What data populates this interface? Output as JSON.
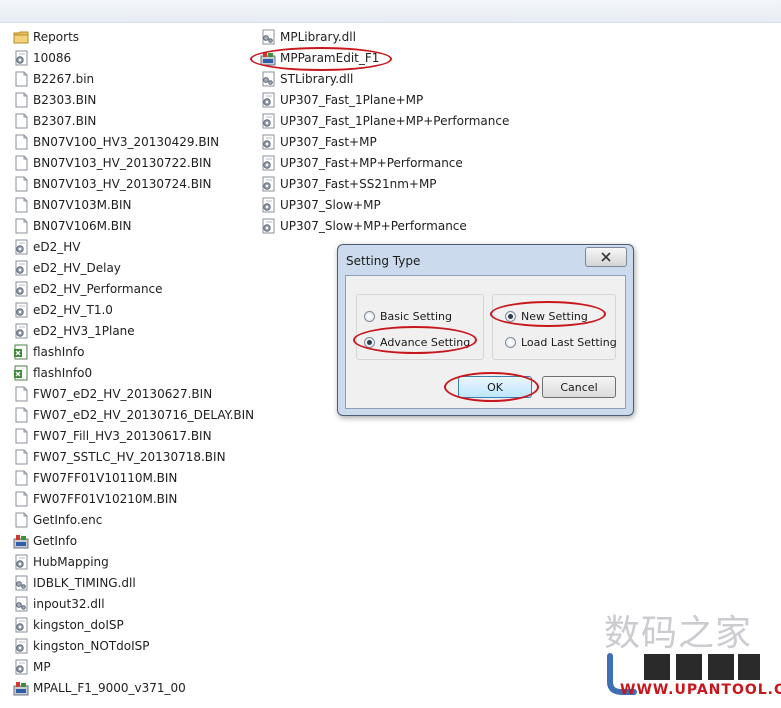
{
  "files_left": [
    {
      "name": "Reports",
      "icon": "folder-icon"
    },
    {
      "name": "10086",
      "icon": "config-file-icon"
    },
    {
      "name": "B2267.bin",
      "icon": "blank-file-icon"
    },
    {
      "name": "B2303.BIN",
      "icon": "blank-file-icon"
    },
    {
      "name": "B2307.BIN",
      "icon": "blank-file-icon"
    },
    {
      "name": "BN07V100_HV3_20130429.BIN",
      "icon": "blank-file-icon"
    },
    {
      "name": "BN07V103_HV_20130722.BIN",
      "icon": "blank-file-icon"
    },
    {
      "name": "BN07V103_HV_20130724.BIN",
      "icon": "blank-file-icon"
    },
    {
      "name": "BN07V103M.BIN",
      "icon": "blank-file-icon"
    },
    {
      "name": "BN07V106M.BIN",
      "icon": "blank-file-icon"
    },
    {
      "name": "eD2_HV",
      "icon": "config-file-icon"
    },
    {
      "name": "eD2_HV_Delay",
      "icon": "config-file-icon"
    },
    {
      "name": "eD2_HV_Performance",
      "icon": "config-file-icon"
    },
    {
      "name": "eD2_HV_T1.0",
      "icon": "config-file-icon"
    },
    {
      "name": "eD2_HV3_1Plane",
      "icon": "config-file-icon"
    },
    {
      "name": "flashInfo",
      "icon": "spreadsheet-file-icon"
    },
    {
      "name": "flashInfo0",
      "icon": "spreadsheet-file-icon"
    },
    {
      "name": "FW07_eD2_HV_20130627.BIN",
      "icon": "blank-file-icon"
    },
    {
      "name": "FW07_eD2_HV_20130716_DELAY.BIN",
      "icon": "blank-file-icon"
    },
    {
      "name": "FW07_Fill_HV3_20130617.BIN",
      "icon": "blank-file-icon"
    },
    {
      "name": "FW07_SSTLC_HV_20130718.BIN",
      "icon": "blank-file-icon"
    },
    {
      "name": "FW07FF01V10110M.BIN",
      "icon": "blank-file-icon"
    },
    {
      "name": "FW07FF01V10210M.BIN",
      "icon": "blank-file-icon"
    },
    {
      "name": "GetInfo.enc",
      "icon": "blank-file-icon"
    },
    {
      "name": "GetInfo",
      "icon": "application-icon"
    },
    {
      "name": "HubMapping",
      "icon": "config-file-icon"
    },
    {
      "name": "IDBLK_TIMING.dll",
      "icon": "dll-file-icon"
    },
    {
      "name": "inpout32.dll",
      "icon": "dll-file-icon"
    },
    {
      "name": "kingston_doISP",
      "icon": "config-file-icon"
    },
    {
      "name": "kingston_NOTdoISP",
      "icon": "config-file-icon"
    },
    {
      "name": "MP",
      "icon": "config-file-icon"
    },
    {
      "name": "MPALL_F1_9000_v371_00",
      "icon": "application-icon"
    }
  ],
  "files_right": [
    {
      "name": "MPLibrary.dll",
      "icon": "dll-file-icon"
    },
    {
      "name": "MPParamEdit_F1",
      "icon": "application-icon"
    },
    {
      "name": "STLibrary.dll",
      "icon": "dll-file-icon"
    },
    {
      "name": "UP307_Fast_1Plane+MP",
      "icon": "config-file-icon"
    },
    {
      "name": "UP307_Fast_1Plane+MP+Performance",
      "icon": "config-file-icon"
    },
    {
      "name": "UP307_Fast+MP",
      "icon": "config-file-icon"
    },
    {
      "name": "UP307_Fast+MP+Performance",
      "icon": "config-file-icon"
    },
    {
      "name": "UP307_Fast+SS21nm+MP",
      "icon": "config-file-icon"
    },
    {
      "name": "UP307_Slow+MP",
      "icon": "config-file-icon"
    },
    {
      "name": "UP307_Slow+MP+Performance",
      "icon": "config-file-icon"
    }
  ],
  "dialog": {
    "title": "Setting Type",
    "close_icon": "close-icon",
    "setting_level": {
      "options": [
        "Basic Setting",
        "Advance Setting"
      ],
      "selected": "Advance Setting"
    },
    "setting_mode": {
      "options": [
        "New Setting",
        "Load Last Setting"
      ],
      "selected": "New Setting"
    },
    "ok_label": "OK",
    "cancel_label": "Cancel"
  },
  "watermark": {
    "site_name": "数码之家",
    "site_url": "WWW.UPANTOOL.COM"
  },
  "colors": {
    "highlight_ring": "#c8161d",
    "dialog_frame": "#cbdaec"
  }
}
